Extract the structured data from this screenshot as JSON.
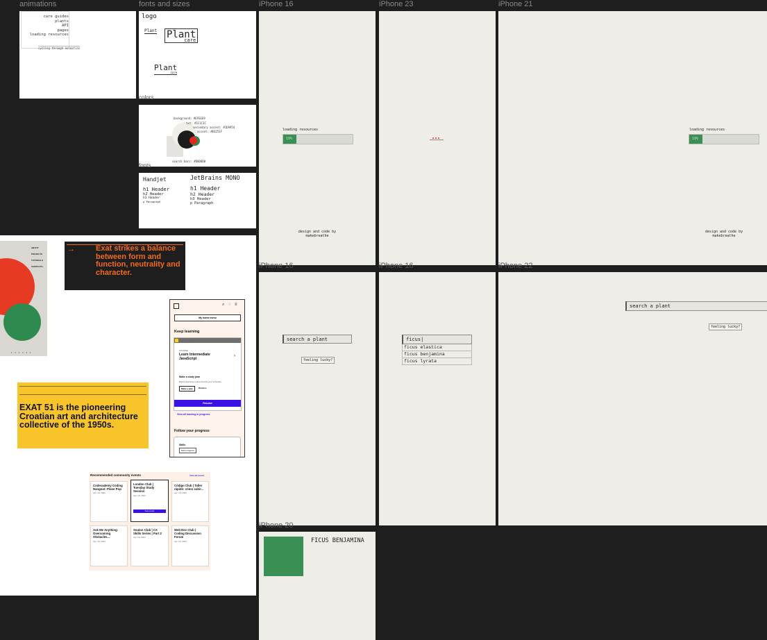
{
  "frame_labels": {
    "animations": "animations",
    "fonts_sizes": "fonts and sizes",
    "iphone16": "iPhone 16",
    "iphone23": "iPhone 23",
    "iphone21": "iPhone 21",
    "iphone_mid1": "iPhone 16",
    "iphone_mid2": "iPhone 16",
    "iphone22": "iPhone 22",
    "iphone_bottom": "iPhone 20",
    "colors": "colors",
    "fonts": "fonts"
  },
  "animations": {
    "list": [
      "care guides",
      "plants",
      "API",
      "pages",
      "loading resources"
    ],
    "caption": "cycling through animation"
  },
  "logo": {
    "heading": "logo",
    "word": "Plant",
    "sub": "care"
  },
  "colors": {
    "background": "background: #EFEEE9",
    "txt": "txt: #1C1C1C",
    "secondary": "secondary accent: #1DA954",
    "accent": "accent: #E6251F",
    "search": "search bars: #D8D8D8",
    "accent_hex": "#E6251F",
    "secondary_hex": "#2F8A4E",
    "dark_hex": "#1C1C1C"
  },
  "fonts": {
    "handjet": "Handjet",
    "jetbrains": "JetBrains MONO",
    "h1": "h1 Header",
    "h2": "h2 Header",
    "h3": "h3 Header",
    "p": "p Paragraph"
  },
  "loading": {
    "label": "loading resources",
    "percent": "19%",
    "progress": 0.19,
    "footer_line1": "design and code by",
    "footer_line2": "makebreathe"
  },
  "search": {
    "placeholder": "search a plant",
    "lucky": "feeling lucky?",
    "typed": "ficus|",
    "suggestions": [
      "ficus elastica",
      "ficus benjamina",
      "ficus lyrata"
    ]
  },
  "plant_detail": {
    "name": "FICUS BENJAMINA",
    "swatch": "#3a8f55"
  },
  "moodboard": {
    "nav": [
      "ABOUT",
      "PROJECTS",
      "TUTORIALS",
      "CONTACTS"
    ],
    "exat_banner": "Exat strikes a balance between form and function, neutrality and character.",
    "exat_yellow": "EXAT 51 is the pioneering Croatian art and architecture collective of the 1950s.",
    "mobile": {
      "menu": "My home menu",
      "keep_learning": "Keep learning",
      "course_tag": "COURSE",
      "course_title": "Learn Intermediate JavaScript",
      "study_plan": "Make a study plan",
      "study_desc": "Build a learning routine that fits your schedule.",
      "make_plan": "Make a plan",
      "dismiss": "Dismiss",
      "resume": "Resume",
      "view_all": "View all learning in progress",
      "follow": "Follow your progress",
      "skills": "Skills",
      "most_progress": "Most progress"
    },
    "events": {
      "heading": "Recommended community events",
      "view_all": "View all events",
      "cards": [
        {
          "title": "Codecademy Coding Hangout: Plane Pop",
          "meta": "Apr. 16, 2024"
        },
        {
          "title": "London Club | Tuesday Study Session",
          "meta": "Apr. 16, 2024"
        },
        {
          "title": "Código Club | Taller rápido: cómo subir...",
          "meta": "Apr. 16, 2024"
        },
        {
          "title": "Ask Me Anything: Overcoming Obstacles...",
          "meta": "Apr. 16, 2024"
        },
        {
          "title": "Soulon Club | CX Skills Series | Part 2",
          "meta": "Apr. 16, 2024"
        },
        {
          "title": "Web Dev Club | Coding Discussion Forum",
          "meta": "Apr. 16, 2024"
        }
      ],
      "cta": "Save a spot"
    }
  }
}
